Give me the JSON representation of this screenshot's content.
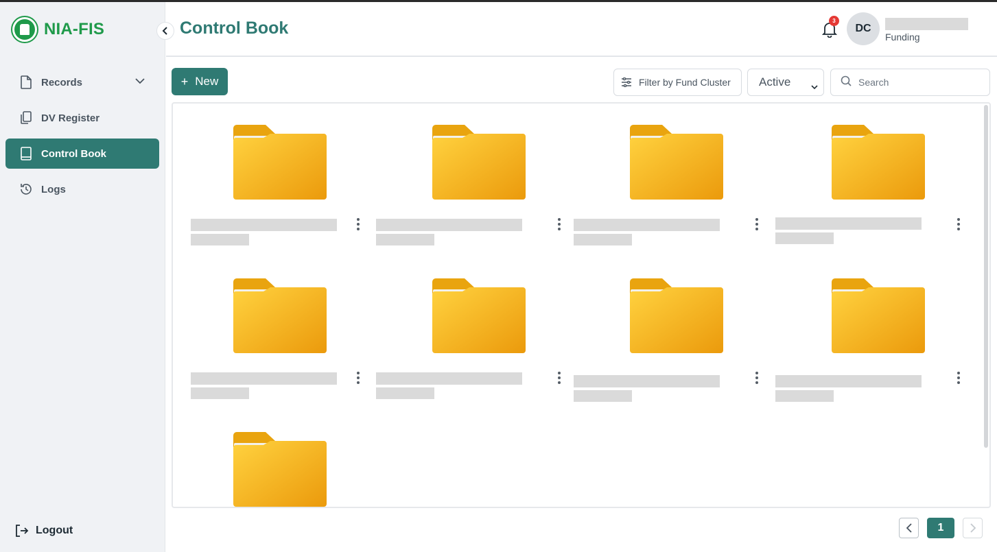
{
  "app": {
    "name": "NIA-FIS"
  },
  "sidebar": {
    "items": [
      {
        "label": "Records",
        "icon": "file-icon",
        "expandable": true
      },
      {
        "label": "DV Register",
        "icon": "copy-icon"
      },
      {
        "label": "Control Book",
        "icon": "book-icon",
        "active": true
      },
      {
        "label": "Logs",
        "icon": "history-icon"
      }
    ],
    "logout_label": "Logout"
  },
  "header": {
    "title": "Control Book",
    "notifications_count": "3",
    "user_initials": "DC",
    "user_role": "Funding"
  },
  "toolbar": {
    "new_label": "New",
    "filter_label": "Filter by Fund Cluster",
    "status_value": "Active",
    "search_placeholder": "Search"
  },
  "folders_count": 9,
  "pagination": {
    "current_page": "1"
  },
  "colors": {
    "brand_green": "#1f9a4a",
    "primary_teal": "#2f7a73",
    "folder_yellow": "#f5b21a",
    "badge_red": "#e53935"
  }
}
